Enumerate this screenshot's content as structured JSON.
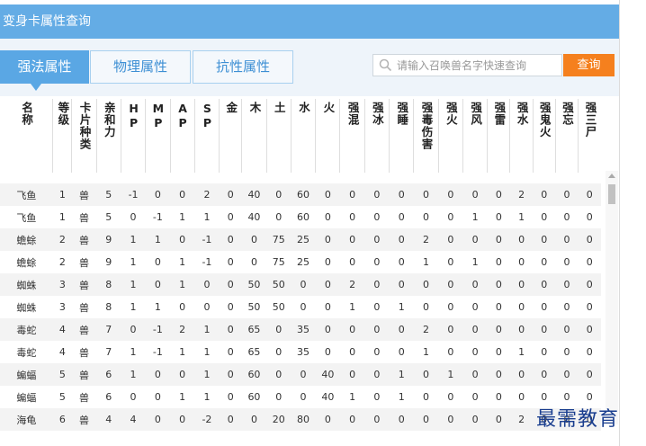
{
  "window": {
    "title": "变身卡属性查询"
  },
  "tabs": [
    {
      "label": "强法属性",
      "active": true
    },
    {
      "label": "物理属性",
      "active": false
    },
    {
      "label": "抗性属性",
      "active": false
    }
  ],
  "search": {
    "placeholder": "请输入召唤兽名字快速查询",
    "value": "",
    "button_label": "查询",
    "icon": "search-icon"
  },
  "table": {
    "headers": [
      "名称",
      "等级",
      "卡片种类",
      "亲和力",
      "HP",
      "MP",
      "AP",
      "SP",
      "金",
      "木",
      "土",
      "水",
      "火",
      "强混",
      "强冰",
      "强睡",
      "强毒伤害",
      "强火",
      "强风",
      "强雷",
      "强水",
      "强鬼火",
      "强忘",
      "强三尸"
    ],
    "rows": [
      [
        "飞鱼",
        "1",
        "兽",
        "5",
        "-1",
        "0",
        "0",
        "2",
        "0",
        "40",
        "0",
        "60",
        "0",
        "0",
        "0",
        "0",
        "0",
        "0",
        "0",
        "0",
        "2",
        "0",
        "0",
        "0"
      ],
      [
        "飞鱼",
        "1",
        "兽",
        "5",
        "0",
        "-1",
        "1",
        "1",
        "0",
        "40",
        "0",
        "60",
        "0",
        "0",
        "0",
        "0",
        "0",
        "0",
        "1",
        "0",
        "1",
        "0",
        "0",
        "0"
      ],
      [
        "蟾蜍",
        "2",
        "兽",
        "9",
        "1",
        "1",
        "0",
        "-1",
        "0",
        "0",
        "75",
        "25",
        "0",
        "0",
        "0",
        "0",
        "2",
        "0",
        "0",
        "0",
        "0",
        "0",
        "0",
        "0"
      ],
      [
        "蟾蜍",
        "2",
        "兽",
        "9",
        "1",
        "0",
        "1",
        "-1",
        "0",
        "0",
        "75",
        "25",
        "0",
        "0",
        "0",
        "0",
        "1",
        "0",
        "1",
        "0",
        "0",
        "0",
        "0",
        "0"
      ],
      [
        "蜘蛛",
        "3",
        "兽",
        "8",
        "1",
        "0",
        "1",
        "0",
        "0",
        "50",
        "50",
        "0",
        "0",
        "2",
        "0",
        "0",
        "0",
        "0",
        "0",
        "0",
        "0",
        "0",
        "0",
        "0"
      ],
      [
        "蜘蛛",
        "3",
        "兽",
        "8",
        "1",
        "1",
        "0",
        "0",
        "0",
        "50",
        "50",
        "0",
        "0",
        "1",
        "0",
        "1",
        "0",
        "0",
        "0",
        "0",
        "0",
        "0",
        "0",
        "0"
      ],
      [
        "毒蛇",
        "4",
        "兽",
        "7",
        "0",
        "-1",
        "2",
        "1",
        "0",
        "65",
        "0",
        "35",
        "0",
        "0",
        "0",
        "0",
        "2",
        "0",
        "0",
        "0",
        "0",
        "0",
        "0",
        "0"
      ],
      [
        "毒蛇",
        "4",
        "兽",
        "7",
        "1",
        "-1",
        "1",
        "1",
        "0",
        "65",
        "0",
        "35",
        "0",
        "0",
        "0",
        "0",
        "1",
        "0",
        "0",
        "0",
        "1",
        "0",
        "0",
        "0"
      ],
      [
        "蝙蝠",
        "5",
        "兽",
        "6",
        "1",
        "0",
        "0",
        "1",
        "0",
        "60",
        "0",
        "0",
        "40",
        "0",
        "0",
        "1",
        "0",
        "1",
        "0",
        "0",
        "0",
        "0",
        "0",
        "0"
      ],
      [
        "蝙蝠",
        "5",
        "兽",
        "6",
        "0",
        "0",
        "1",
        "1",
        "0",
        "60",
        "0",
        "0",
        "40",
        "1",
        "0",
        "1",
        "0",
        "0",
        "0",
        "0",
        "0",
        "0",
        "0",
        "0"
      ],
      [
        "海龟",
        "6",
        "兽",
        "4",
        "4",
        "0",
        "0",
        "-2",
        "0",
        "0",
        "20",
        "80",
        "0",
        "0",
        "0",
        "0",
        "0",
        "0",
        "0",
        "0",
        "2",
        "0",
        "0",
        "0"
      ]
    ]
  },
  "watermark": "最需教育"
}
